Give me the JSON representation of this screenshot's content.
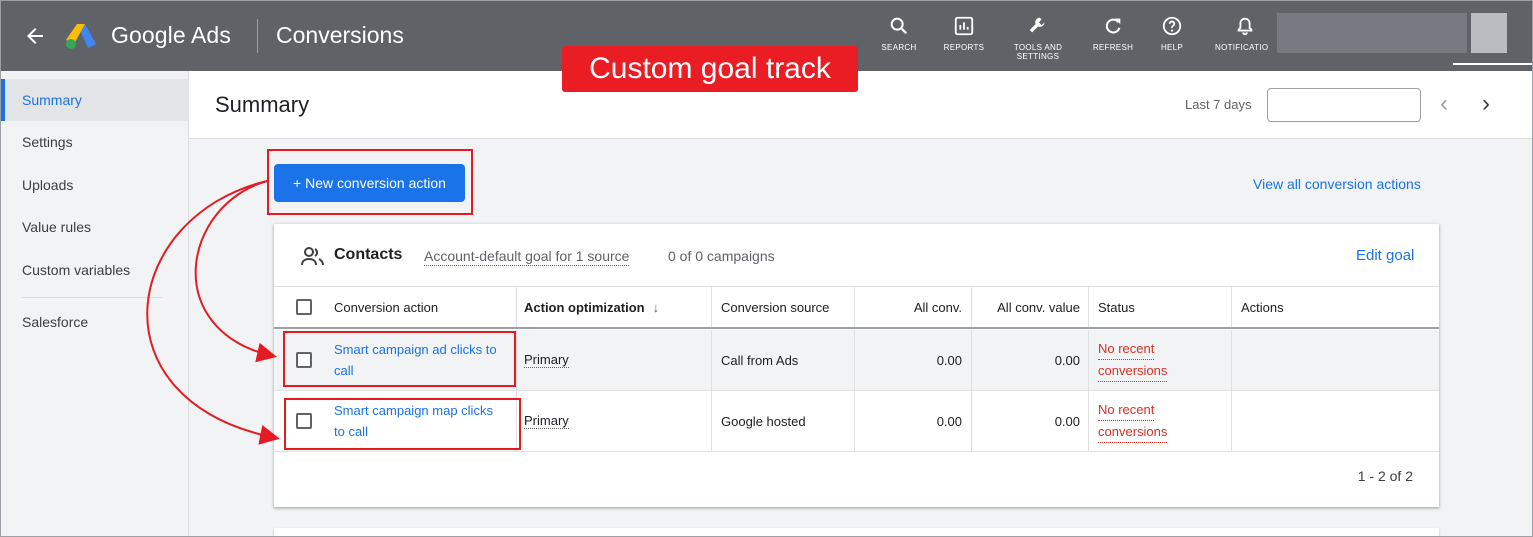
{
  "topbar": {
    "brand": "Google Ads",
    "page": "Conversions",
    "tools": [
      {
        "label": "SEARCH",
        "icon": "search-icon"
      },
      {
        "label": "REPORTS",
        "icon": "reports-icon"
      },
      {
        "label": "TOOLS AND SETTINGS",
        "icon": "wrench-icon"
      },
      {
        "label": "REFRESH",
        "icon": "refresh-icon"
      },
      {
        "label": "HELP",
        "icon": "help-icon"
      },
      {
        "label": "NOTIFICATIO",
        "icon": "bell-icon"
      }
    ]
  },
  "banner": "Custom goal track",
  "sidebar": {
    "items": [
      {
        "label": "Summary"
      },
      {
        "label": "Settings"
      },
      {
        "label": "Uploads"
      },
      {
        "label": "Value rules"
      },
      {
        "label": "Custom variables"
      },
      {
        "label": "Salesforce"
      }
    ]
  },
  "header": {
    "title": "Summary",
    "range_label": "Last 7 days",
    "prev": "‹",
    "next": "›"
  },
  "actions": {
    "new_button": "+ New conversion action",
    "view_all": "View all conversion actions"
  },
  "card": {
    "title": "Contacts",
    "goal_desc": "Account-default goal for 1 source",
    "campaigns": "0 of 0 campaigns",
    "edit_goal": "Edit goal",
    "columns": [
      "Conversion action",
      "Action optimization",
      "Conversion source",
      "All conv.",
      "All conv. value",
      "Status",
      "Actions"
    ],
    "sort_indicator": "↓",
    "rows": [
      {
        "action_line1": "Smart campaign ad clicks to",
        "action_line2": "call",
        "optimization": "Primary",
        "source": "Call from Ads",
        "all_conv": "0.00",
        "all_conv_value": "0.00",
        "status_line1": "No recent",
        "status_line2": "conversions"
      },
      {
        "action_line1": "Smart campaign map clicks",
        "action_line2": "to call",
        "optimization": "Primary",
        "source": "Google hosted",
        "all_conv": "0.00",
        "all_conv_value": "0.00",
        "status_line1": "No recent",
        "status_line2": "conversions"
      }
    ],
    "pager": "1 - 2 of 2"
  },
  "colors": {
    "topbar": "#5f6368",
    "accent": "#1a73e8",
    "annotation_red": "#e51b23",
    "status_red": "#d93025"
  }
}
